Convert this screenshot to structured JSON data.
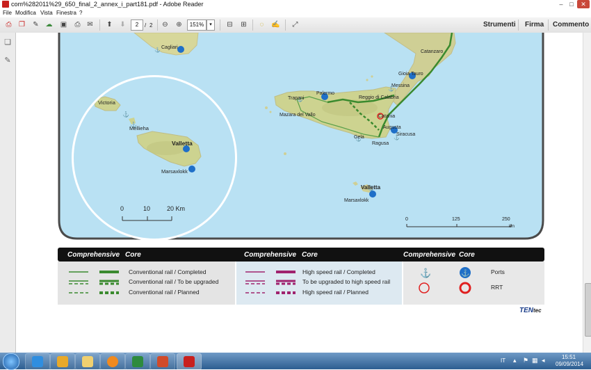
{
  "window": {
    "title": "com%282011%29_650_final_2_annex_i_part181.pdf - Adobe Reader",
    "minimize": "–",
    "maximize": "□",
    "close": "✕"
  },
  "menu": [
    "File",
    "Modifica",
    "Vista",
    "Finestra",
    "?"
  ],
  "toolbar": {
    "page_current": "2",
    "page_separator": "/",
    "page_total": "2",
    "zoom": "151%",
    "right_buttons": [
      "Strumenti",
      "Firma",
      "Commento"
    ]
  },
  "map": {
    "inset_places": [
      "Victoria",
      "Mellieha",
      "Valletta",
      "Marsaxlokk"
    ],
    "inset_scale": {
      "ticks": [
        "0",
        "10",
        "20 Km"
      ]
    },
    "places": {
      "cagliari": "Cagliari",
      "catanzaro": "Catanzaro",
      "gioia_tauro": "Gioia Tauro",
      "messina": "Messina",
      "trapani": "Trapani",
      "palermo": "Palermo",
      "reggio": "Reggio di Calabria",
      "mazara": "Mazara del Vallo",
      "catania": "Catania",
      "augusta": "Augusta",
      "siracusa": "Siracusa",
      "gela": "Gela",
      "ragusa": "Ragusa",
      "valletta": "Valletta",
      "marsaxlokk": "Marsaxlokk"
    },
    "scale": {
      "ticks": [
        "0",
        "125",
        "250"
      ],
      "unit": "km"
    }
  },
  "legend": {
    "headers": {
      "g1_comprehensive": "Comprehensive",
      "g1_core": "Core",
      "g2_comprehensive": "Comprehensive",
      "g2_core": "Core",
      "g3_comprehensive": "Comprehensive",
      "g3_core": "Core"
    },
    "conventional": [
      "Conventional rail / Completed",
      "Conventional rail / To be upgraded",
      "Conventional rail / Planned"
    ],
    "high_speed": [
      "High speed rail / Completed",
      "To be upgraded to high speed rail",
      "High speed rail / Planned"
    ],
    "ports_label": "Ports",
    "rrt_label": "RRT",
    "colors": {
      "conventional": "#3a8a2e",
      "high_speed": "#a0226e",
      "port_comprehensive": "#1f6fc8",
      "port_core": "#1f6fc8",
      "rrt": "#e02020",
      "header_bg": "#111111"
    }
  },
  "brand": {
    "prefix": "TEN",
    "suffix": "tec"
  },
  "taskbar": {
    "language": "IT",
    "time": "15:51",
    "date": "09/09/2014"
  }
}
